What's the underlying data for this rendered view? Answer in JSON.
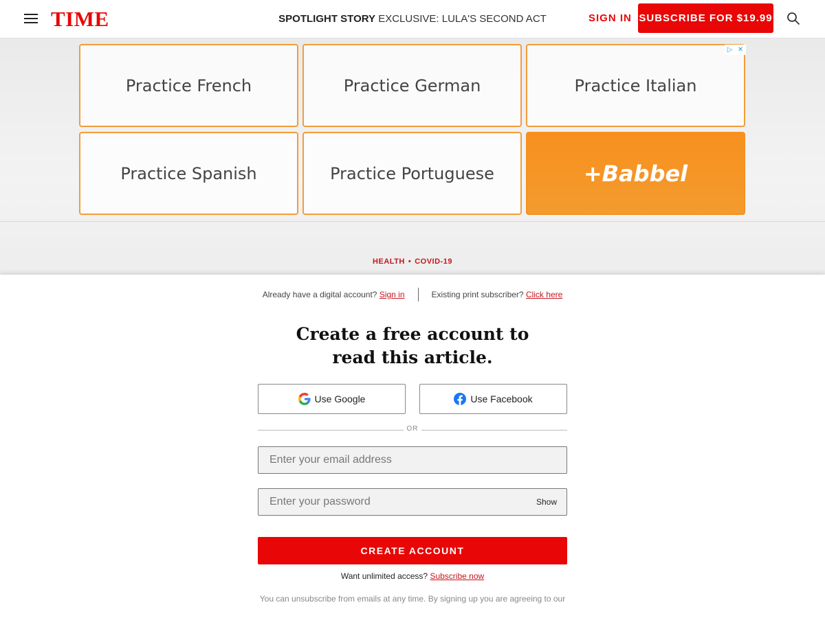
{
  "header": {
    "logo": "TIME",
    "spotlight_label": "SPOTLIGHT STORY",
    "spotlight_story": "EXCLUSIVE: LULA'S SECOND ACT",
    "sign_in": "SIGN IN",
    "subscribe": "SUBSCRIBE FOR $19.99",
    "brand_color": "#e90606"
  },
  "ad": {
    "tiles": [
      {
        "label": "Practice French"
      },
      {
        "label": "Practice German"
      },
      {
        "label": "Practice Italian"
      },
      {
        "label": "Practice Spanish"
      },
      {
        "label": "Practice Portuguese"
      },
      {
        "label": "+Babbel"
      }
    ],
    "accent_color": "#f7901e"
  },
  "breadcrumb": {
    "section": "HEALTH",
    "topic": "COVID-19"
  },
  "modal": {
    "digital_prompt": "Already have a digital account?",
    "digital_link": "Sign in",
    "print_prompt": "Existing print subscriber?",
    "print_link": "Click here",
    "headline_line1": "Create a free account to",
    "headline_line2": "read this article.",
    "google_button": "Use Google",
    "facebook_button": "Use Facebook",
    "or_label": "OR",
    "email_placeholder": "Enter your email address",
    "password_placeholder": "Enter your password",
    "show_label": "Show",
    "create_button": "CREATE ACCOUNT",
    "unlimited_prompt": "Want unlimited access?",
    "unlimited_link": "Subscribe now",
    "legal_text": "You can unsubscribe from emails at any time. By signing up you are agreeing to our"
  }
}
